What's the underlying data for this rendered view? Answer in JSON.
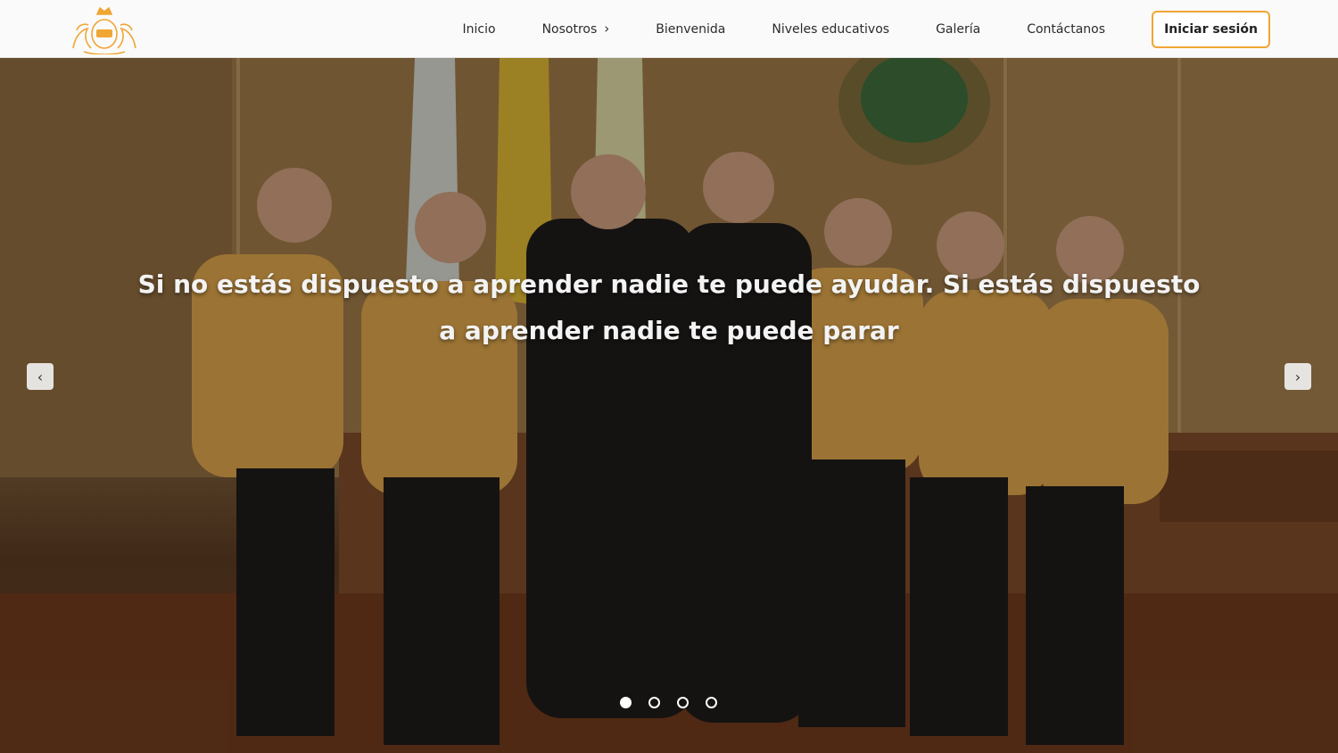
{
  "nav": {
    "items": [
      {
        "label": "Inicio",
        "has_submenu": false
      },
      {
        "label": "Nosotros",
        "has_submenu": true
      },
      {
        "label": "Bienvenida",
        "has_submenu": false
      },
      {
        "label": "Niveles educativos",
        "has_submenu": false
      },
      {
        "label": "Galería",
        "has_submenu": false
      },
      {
        "label": "Contáctanos",
        "has_submenu": false
      }
    ],
    "submenu_icon": "chevron-right-icon",
    "login_label": "Iniciar sesión"
  },
  "brand": {
    "logo_icon": "crest-logo-icon",
    "accent_color": "#f0a634"
  },
  "hero": {
    "quote": "Si no estás dispuesto a aprender nadie te puede ayudar. Si estás dispuesto a aprender nadie te puede parar",
    "prev_icon": "chevron-left-icon",
    "next_icon": "chevron-right-icon",
    "slide_count": 4,
    "active_slide": 1
  }
}
